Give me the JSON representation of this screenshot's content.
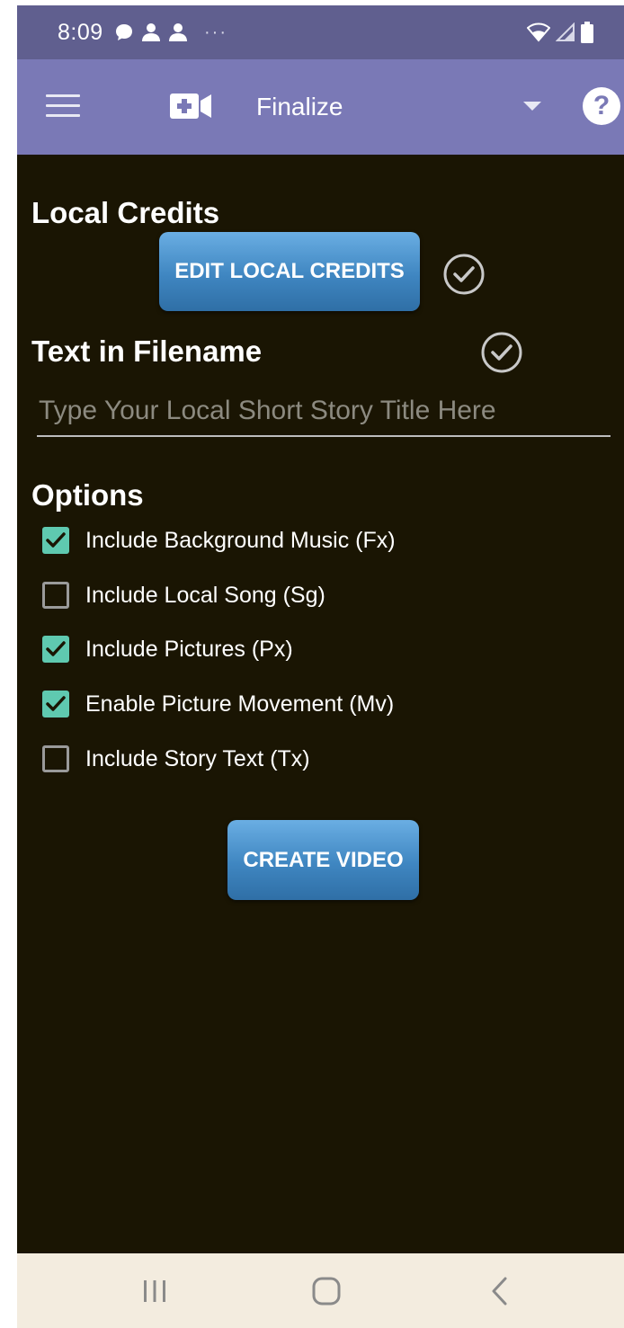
{
  "status_bar": {
    "time": "8:09",
    "left_icons": [
      "chat-bubble-icon",
      "person-icon",
      "person-icon",
      "more-dots-icon"
    ],
    "more_dots": "···",
    "right_icons": [
      "wifi-icon",
      "cell-signal-icon",
      "battery-icon"
    ]
  },
  "app_bar": {
    "title": "Finalize",
    "icons": [
      "menu-icon",
      "video-add-icon",
      "dropdown-arrow-icon",
      "help-icon"
    ],
    "help_glyph": "?"
  },
  "local_credits": {
    "heading": "Local Credits",
    "button_label": "EDIT LOCAL CREDITS",
    "status_icon": "check-circle-icon"
  },
  "filename": {
    "heading": "Text in Filename",
    "status_icon": "check-circle-icon",
    "input_value": "",
    "input_placeholder": "Type Your Local Short Story Title Here"
  },
  "options": {
    "heading": "Options",
    "items": [
      {
        "label": "Include Background Music (Fx)",
        "checked": true
      },
      {
        "label": "Include Local Song (Sg)",
        "checked": false
      },
      {
        "label": "Include Pictures (Px)",
        "checked": true
      },
      {
        "label": "Enable Picture Movement (Mv)",
        "checked": true
      },
      {
        "label": "Include Story Text (Tx)",
        "checked": false
      }
    ]
  },
  "create_button_label": "CREATE VIDEO",
  "nav_bar": {
    "icons": [
      "recent-apps-icon",
      "home-icon",
      "back-icon"
    ]
  },
  "colors": {
    "status_bar": "#605f8f",
    "app_bar": "#7a79b6",
    "content_bg": "#1a1503",
    "checkbox_on": "#5fc9b0",
    "button": "#3f86c1",
    "nav_bar": "#f3ecdf"
  }
}
